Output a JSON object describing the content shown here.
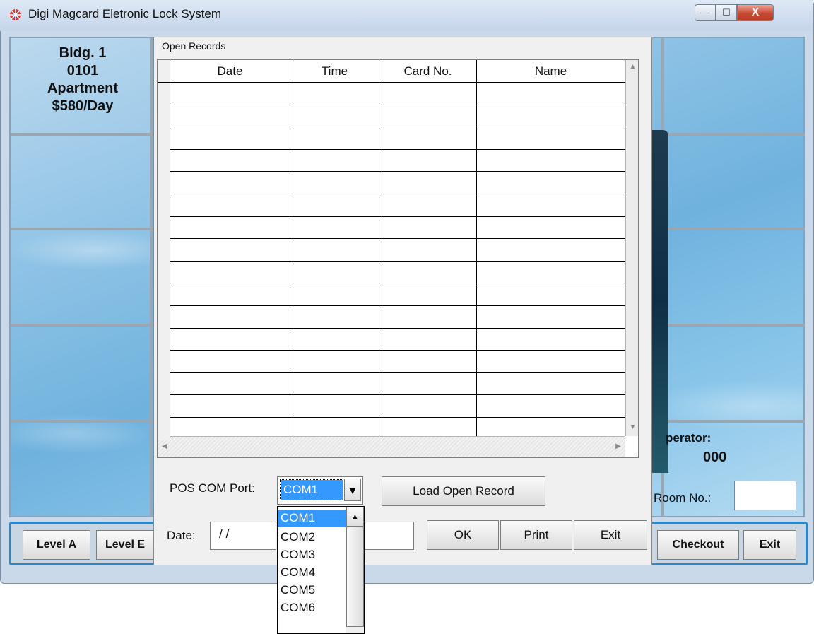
{
  "window": {
    "title": "Digi Magcard Eletronic Lock System",
    "controls": {
      "minimize": "—",
      "maximize": "☐",
      "close": "X"
    }
  },
  "room_card": {
    "building": "Bldg. 1",
    "room": "0101",
    "type": "Apartment",
    "rate": "$580/Day"
  },
  "operator": {
    "label": "perator:",
    "value": "000"
  },
  "room_no": {
    "label": "Room No.:",
    "value": ""
  },
  "bottom_bar": {
    "level_a": "Level A",
    "level_b": "Level E",
    "checkout": "Checkout",
    "exit": "Exit"
  },
  "dialog": {
    "title": "Open Records",
    "table": {
      "columns": [
        "Date",
        "Time",
        "Card No.",
        "Name"
      ],
      "rows": []
    },
    "pos_com_port_label": "POS COM Port:",
    "com_port_value": "COM1",
    "load_button": "Load Open Record",
    "date_label": "Date:",
    "date_value": " / /",
    "ok_button": "OK",
    "print_button": "Print",
    "exit_button": "Exit"
  },
  "com_dropdown": {
    "options": [
      "COM1",
      "COM2",
      "COM3",
      "COM4",
      "COM5",
      "COM6"
    ],
    "selected": "COM1"
  },
  "colors": {
    "accent": "#3399ff",
    "bar_border": "#2f86c8",
    "close_red": "#c84a32"
  }
}
